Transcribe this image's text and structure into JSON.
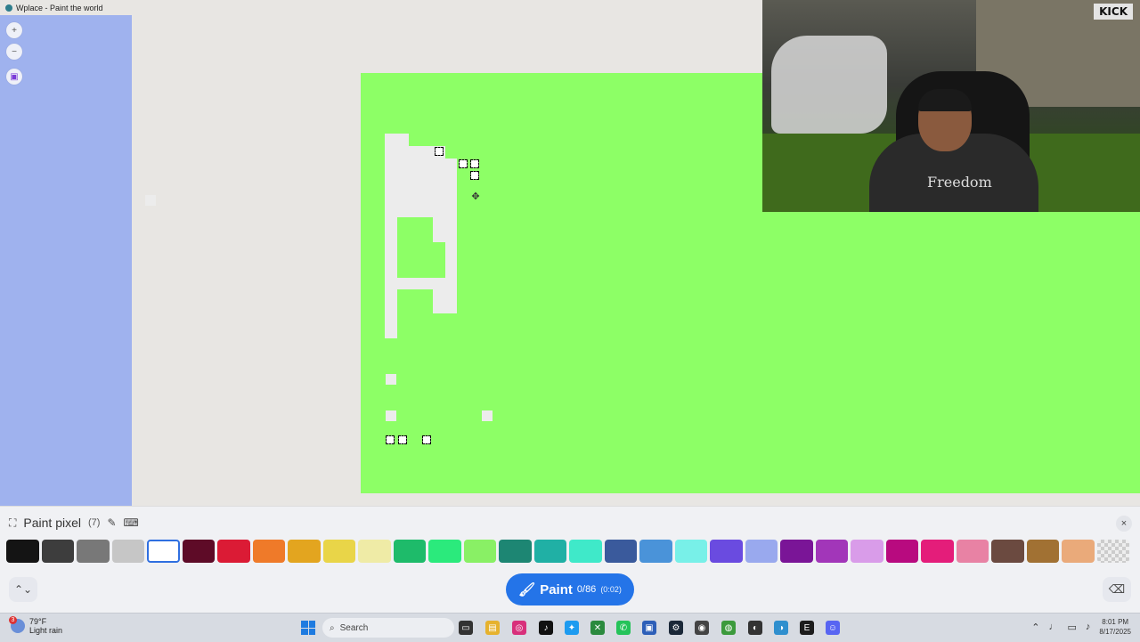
{
  "window": {
    "title": "Wplace - Paint the world"
  },
  "map_controls": {
    "zoom_in": "+",
    "zoom_out": "−"
  },
  "webcam": {
    "logo": "KICK",
    "shirt_text": "Freedom"
  },
  "paint_panel": {
    "title": "Paint pixel",
    "count": "(7)",
    "close": "×",
    "paint_label": "Paint",
    "paint_progress": "0/86",
    "paint_timer": "(0:02)"
  },
  "palette": [
    {
      "color": "#141414"
    },
    {
      "color": "#3d3d3d"
    },
    {
      "color": "#787878"
    },
    {
      "color": "#c6c6c6"
    },
    {
      "color": "#ffffff",
      "selected": true
    },
    {
      "color": "#5e0b27"
    },
    {
      "color": "#db1b35"
    },
    {
      "color": "#ef7a29"
    },
    {
      "color": "#e3a51f"
    },
    {
      "color": "#e9d548"
    },
    {
      "color": "#efeba6"
    },
    {
      "color": "#1ebb6a"
    },
    {
      "color": "#2bea7c"
    },
    {
      "color": "#89f065"
    },
    {
      "color": "#1d8673"
    },
    {
      "color": "#20b0a5"
    },
    {
      "color": "#3fe9c9"
    },
    {
      "color": "#3a5a9c"
    },
    {
      "color": "#4a93d9"
    },
    {
      "color": "#78f0e8"
    },
    {
      "color": "#6a4be0"
    },
    {
      "color": "#99a9ee"
    },
    {
      "color": "#7a1597"
    },
    {
      "color": "#a236b9"
    },
    {
      "color": "#d99ce9"
    },
    {
      "color": "#b80a7f"
    },
    {
      "color": "#e41d7a"
    },
    {
      "color": "#e882a4"
    },
    {
      "color": "#6b4a40"
    },
    {
      "color": "#a17133"
    },
    {
      "color": "#eaaa7a"
    },
    {
      "color": "transparent"
    }
  ],
  "taskbar": {
    "weather_badge": "3",
    "temperature": "79°F",
    "condition": "Light rain",
    "search_placeholder": "Search",
    "time": "8:01 PM",
    "date": "8/17/2025"
  },
  "colors": {
    "canvas_green": "#8dff66",
    "left_panel": "#9fb2ee",
    "accent": "#2474e8"
  }
}
